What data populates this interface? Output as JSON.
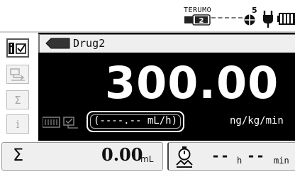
{
  "status_bar": {
    "brand": "TERUMO",
    "syringe_badge": "2",
    "pressure_level": "5",
    "icons": [
      "syringe-icon",
      "pressure-occlusion-icon",
      "ac-plug-icon",
      "battery-icon"
    ]
  },
  "sidebar": {
    "items": [
      {
        "name": "info-check",
        "glyph": "i☑"
      },
      {
        "name": "device",
        "glyph": "⇄"
      },
      {
        "name": "sum",
        "glyph": "Σ"
      },
      {
        "name": "info",
        "glyph": "i"
      }
    ]
  },
  "main": {
    "drug_name": "Drug2",
    "rate_value": "300.00",
    "volume_rate_text": "(----.-- mL/h)",
    "rate_unit": "ng/kg/min",
    "colors": {
      "panel_bg": "#000000",
      "text": "#ffffff"
    }
  },
  "bottom": {
    "sum_symbol": "Σ",
    "total_value": "0.00",
    "total_unit": "mL",
    "time_hours": "--",
    "time_hours_unit": "h",
    "time_minutes": "--",
    "time_minutes_unit": "min"
  }
}
